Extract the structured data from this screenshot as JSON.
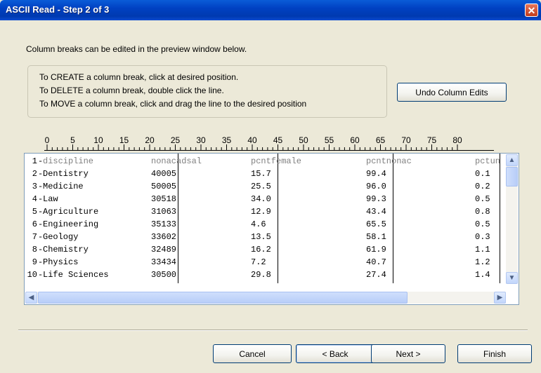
{
  "window": {
    "title": "ASCII Read - Step 2 of 3",
    "close_glyph": "✕"
  },
  "intro_text": "Column breaks can be edited in the preview window below.",
  "instructions": [
    "To CREATE a column break, click at desired position.",
    "To DELETE a column break, double click the line.",
    "To MOVE a column break, click and drag the line to the desired position"
  ],
  "undo_button": "Undo Column Edits",
  "ruler_labels": [
    "0",
    "5",
    "10",
    "15",
    "20",
    "25",
    "30",
    "35",
    "40",
    "45",
    "50",
    "55",
    "60",
    "65",
    "70",
    "75",
    "80"
  ],
  "row_numbers": [
    "1",
    "2",
    "3",
    "4",
    "5",
    "6",
    "7",
    "8",
    "9",
    "10"
  ],
  "columns": [
    "discipline",
    "nonacadsal",
    "pcntfemale",
    "pcntnonac",
    "pctun"
  ],
  "rows": [
    [
      "Dentistry",
      "40005",
      "15.7",
      "99.4",
      "0.1"
    ],
    [
      "Medicine",
      "50005",
      "25.5",
      "96.0",
      "0.2"
    ],
    [
      "Law",
      "30518",
      "34.0",
      "99.3",
      "0.5"
    ],
    [
      "Agriculture",
      "31063",
      "12.9",
      "43.4",
      "0.8"
    ],
    [
      "Engineering",
      "35133",
      "4.6",
      "65.5",
      "0.5"
    ],
    [
      "Geology",
      "33602",
      "13.5",
      "58.1",
      "0.3"
    ],
    [
      "Chemistry",
      "32489",
      "16.2",
      "61.9",
      "1.1"
    ],
    [
      "Physics",
      "33434",
      "7.2",
      "40.7",
      "1.2"
    ],
    [
      "Life Sciences",
      "30500",
      "29.8",
      "27.4",
      "1.4"
    ]
  ],
  "footer": {
    "cancel": "Cancel",
    "back": "< Back",
    "next": "Next >",
    "finish": "Finish"
  },
  "icons": {
    "scroll_up": "scroll-up-icon",
    "scroll_down": "scroll-down-icon",
    "scroll_left": "scroll-left-icon",
    "scroll_right": "scroll-right-icon"
  },
  "colors": {
    "titlebar": "#0041c2",
    "window_bg": "#ece9d8",
    "close": "#c23c1c"
  }
}
